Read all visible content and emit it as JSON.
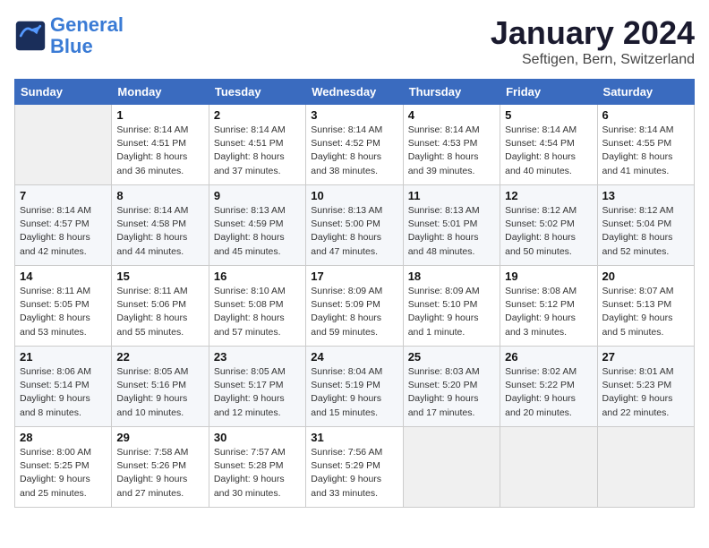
{
  "header": {
    "logo_line1": "General",
    "logo_line2": "Blue",
    "title": "January 2024",
    "subtitle": "Seftigen, Bern, Switzerland"
  },
  "days_of_week": [
    "Sunday",
    "Monday",
    "Tuesday",
    "Wednesday",
    "Thursday",
    "Friday",
    "Saturday"
  ],
  "weeks": [
    [
      {
        "day": "",
        "sunrise": "",
        "sunset": "",
        "daylight": ""
      },
      {
        "day": "1",
        "sunrise": "Sunrise: 8:14 AM",
        "sunset": "Sunset: 4:51 PM",
        "daylight": "Daylight: 8 hours and 36 minutes."
      },
      {
        "day": "2",
        "sunrise": "Sunrise: 8:14 AM",
        "sunset": "Sunset: 4:51 PM",
        "daylight": "Daylight: 8 hours and 37 minutes."
      },
      {
        "day": "3",
        "sunrise": "Sunrise: 8:14 AM",
        "sunset": "Sunset: 4:52 PM",
        "daylight": "Daylight: 8 hours and 38 minutes."
      },
      {
        "day": "4",
        "sunrise": "Sunrise: 8:14 AM",
        "sunset": "Sunset: 4:53 PM",
        "daylight": "Daylight: 8 hours and 39 minutes."
      },
      {
        "day": "5",
        "sunrise": "Sunrise: 8:14 AM",
        "sunset": "Sunset: 4:54 PM",
        "daylight": "Daylight: 8 hours and 40 minutes."
      },
      {
        "day": "6",
        "sunrise": "Sunrise: 8:14 AM",
        "sunset": "Sunset: 4:55 PM",
        "daylight": "Daylight: 8 hours and 41 minutes."
      }
    ],
    [
      {
        "day": "7",
        "sunrise": "Sunrise: 8:14 AM",
        "sunset": "Sunset: 4:57 PM",
        "daylight": "Daylight: 8 hours and 42 minutes."
      },
      {
        "day": "8",
        "sunrise": "Sunrise: 8:14 AM",
        "sunset": "Sunset: 4:58 PM",
        "daylight": "Daylight: 8 hours and 44 minutes."
      },
      {
        "day": "9",
        "sunrise": "Sunrise: 8:13 AM",
        "sunset": "Sunset: 4:59 PM",
        "daylight": "Daylight: 8 hours and 45 minutes."
      },
      {
        "day": "10",
        "sunrise": "Sunrise: 8:13 AM",
        "sunset": "Sunset: 5:00 PM",
        "daylight": "Daylight: 8 hours and 47 minutes."
      },
      {
        "day": "11",
        "sunrise": "Sunrise: 8:13 AM",
        "sunset": "Sunset: 5:01 PM",
        "daylight": "Daylight: 8 hours and 48 minutes."
      },
      {
        "day": "12",
        "sunrise": "Sunrise: 8:12 AM",
        "sunset": "Sunset: 5:02 PM",
        "daylight": "Daylight: 8 hours and 50 minutes."
      },
      {
        "day": "13",
        "sunrise": "Sunrise: 8:12 AM",
        "sunset": "Sunset: 5:04 PM",
        "daylight": "Daylight: 8 hours and 52 minutes."
      }
    ],
    [
      {
        "day": "14",
        "sunrise": "Sunrise: 8:11 AM",
        "sunset": "Sunset: 5:05 PM",
        "daylight": "Daylight: 8 hours and 53 minutes."
      },
      {
        "day": "15",
        "sunrise": "Sunrise: 8:11 AM",
        "sunset": "Sunset: 5:06 PM",
        "daylight": "Daylight: 8 hours and 55 minutes."
      },
      {
        "day": "16",
        "sunrise": "Sunrise: 8:10 AM",
        "sunset": "Sunset: 5:08 PM",
        "daylight": "Daylight: 8 hours and 57 minutes."
      },
      {
        "day": "17",
        "sunrise": "Sunrise: 8:09 AM",
        "sunset": "Sunset: 5:09 PM",
        "daylight": "Daylight: 8 hours and 59 minutes."
      },
      {
        "day": "18",
        "sunrise": "Sunrise: 8:09 AM",
        "sunset": "Sunset: 5:10 PM",
        "daylight": "Daylight: 9 hours and 1 minute."
      },
      {
        "day": "19",
        "sunrise": "Sunrise: 8:08 AM",
        "sunset": "Sunset: 5:12 PM",
        "daylight": "Daylight: 9 hours and 3 minutes."
      },
      {
        "day": "20",
        "sunrise": "Sunrise: 8:07 AM",
        "sunset": "Sunset: 5:13 PM",
        "daylight": "Daylight: 9 hours and 5 minutes."
      }
    ],
    [
      {
        "day": "21",
        "sunrise": "Sunrise: 8:06 AM",
        "sunset": "Sunset: 5:14 PM",
        "daylight": "Daylight: 9 hours and 8 minutes."
      },
      {
        "day": "22",
        "sunrise": "Sunrise: 8:05 AM",
        "sunset": "Sunset: 5:16 PM",
        "daylight": "Daylight: 9 hours and 10 minutes."
      },
      {
        "day": "23",
        "sunrise": "Sunrise: 8:05 AM",
        "sunset": "Sunset: 5:17 PM",
        "daylight": "Daylight: 9 hours and 12 minutes."
      },
      {
        "day": "24",
        "sunrise": "Sunrise: 8:04 AM",
        "sunset": "Sunset: 5:19 PM",
        "daylight": "Daylight: 9 hours and 15 minutes."
      },
      {
        "day": "25",
        "sunrise": "Sunrise: 8:03 AM",
        "sunset": "Sunset: 5:20 PM",
        "daylight": "Daylight: 9 hours and 17 minutes."
      },
      {
        "day": "26",
        "sunrise": "Sunrise: 8:02 AM",
        "sunset": "Sunset: 5:22 PM",
        "daylight": "Daylight: 9 hours and 20 minutes."
      },
      {
        "day": "27",
        "sunrise": "Sunrise: 8:01 AM",
        "sunset": "Sunset: 5:23 PM",
        "daylight": "Daylight: 9 hours and 22 minutes."
      }
    ],
    [
      {
        "day": "28",
        "sunrise": "Sunrise: 8:00 AM",
        "sunset": "Sunset: 5:25 PM",
        "daylight": "Daylight: 9 hours and 25 minutes."
      },
      {
        "day": "29",
        "sunrise": "Sunrise: 7:58 AM",
        "sunset": "Sunset: 5:26 PM",
        "daylight": "Daylight: 9 hours and 27 minutes."
      },
      {
        "day": "30",
        "sunrise": "Sunrise: 7:57 AM",
        "sunset": "Sunset: 5:28 PM",
        "daylight": "Daylight: 9 hours and 30 minutes."
      },
      {
        "day": "31",
        "sunrise": "Sunrise: 7:56 AM",
        "sunset": "Sunset: 5:29 PM",
        "daylight": "Daylight: 9 hours and 33 minutes."
      },
      {
        "day": "",
        "sunrise": "",
        "sunset": "",
        "daylight": ""
      },
      {
        "day": "",
        "sunrise": "",
        "sunset": "",
        "daylight": ""
      },
      {
        "day": "",
        "sunrise": "",
        "sunset": "",
        "daylight": ""
      }
    ]
  ]
}
